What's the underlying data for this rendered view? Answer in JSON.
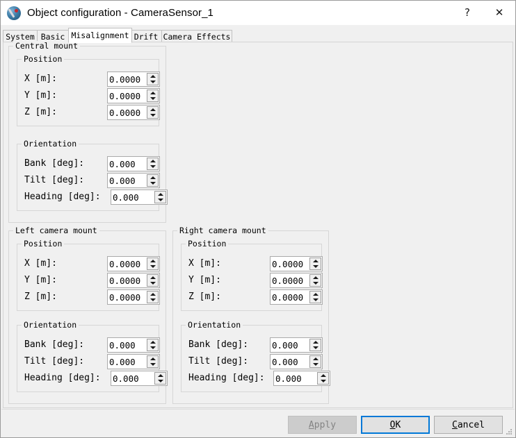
{
  "window": {
    "title": "Object configuration - CameraSensor_1",
    "icon": "app-sphere-icon",
    "help_glyph": "?",
    "close_glyph": "✕"
  },
  "tabs": [
    {
      "label": "System",
      "selected": false
    },
    {
      "label": "Basic",
      "selected": false
    },
    {
      "label": "Misalignment",
      "selected": true
    },
    {
      "label": "Drift",
      "selected": false
    },
    {
      "label": "Camera Effects",
      "selected": false
    }
  ],
  "groups": {
    "central": {
      "label": "Central mount",
      "position": {
        "label": "Position",
        "rows": [
          {
            "label": "X [m]:",
            "value": "0.0000"
          },
          {
            "label": "Y [m]:",
            "value": "0.0000"
          },
          {
            "label": "Z [m]:",
            "value": "0.0000"
          }
        ]
      },
      "orientation": {
        "label": "Orientation",
        "rows": [
          {
            "label": "Bank [deg]:",
            "value": "0.000"
          },
          {
            "label": "Tilt [deg]:",
            "value": "0.000"
          },
          {
            "label": "Heading [deg]:",
            "value": "0.000"
          }
        ]
      }
    },
    "left": {
      "label": "Left camera mount",
      "position": {
        "label": "Position",
        "rows": [
          {
            "label": "X [m]:",
            "value": "0.0000"
          },
          {
            "label": "Y [m]:",
            "value": "0.0000"
          },
          {
            "label": "Z [m]:",
            "value": "0.0000"
          }
        ]
      },
      "orientation": {
        "label": "Orientation",
        "rows": [
          {
            "label": "Bank [deg]:",
            "value": "0.000"
          },
          {
            "label": "Tilt [deg]:",
            "value": "0.000"
          },
          {
            "label": "Heading [deg]:",
            "value": "0.000"
          }
        ]
      }
    },
    "right": {
      "label": "Right camera mount",
      "position": {
        "label": "Position",
        "rows": [
          {
            "label": "X [m]:",
            "value": "0.0000"
          },
          {
            "label": "Y [m]:",
            "value": "0.0000"
          },
          {
            "label": "Z [m]:",
            "value": "0.0000"
          }
        ]
      },
      "orientation": {
        "label": "Orientation",
        "rows": [
          {
            "label": "Bank [deg]:",
            "value": "0.000"
          },
          {
            "label": "Tilt [deg]:",
            "value": "0.000"
          },
          {
            "label": "Heading [deg]:",
            "value": "0.000"
          }
        ]
      }
    }
  },
  "footer": {
    "apply": {
      "mnemonic": "A",
      "rest": "pply",
      "enabled": false
    },
    "ok": {
      "mnemonic": "O",
      "rest": "K",
      "default": true
    },
    "cancel": {
      "mnemonic": "C",
      "rest": "ancel",
      "enabled": true
    }
  },
  "colors": {
    "accent": "#0078d7",
    "dialog_bg": "#f0f0f0",
    "field_bg": "#ffffff",
    "group_border": "#d6d6d6"
  }
}
